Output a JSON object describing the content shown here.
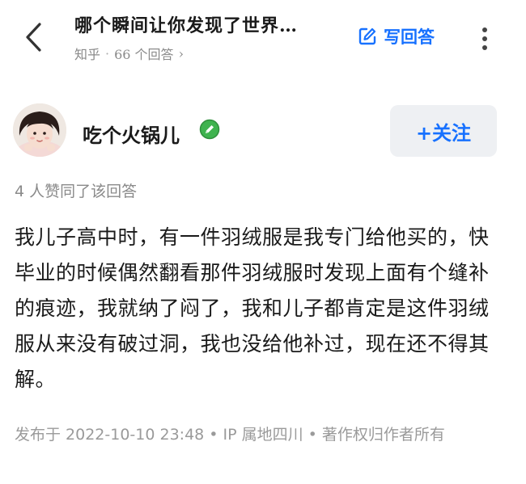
{
  "header": {
    "question_title": "哪个瞬间让你发现了世界…",
    "site_name": "知乎",
    "separator": "·",
    "answer_count": "66 个回答",
    "chevron": "›",
    "write_answer_label": "写回答",
    "back_icon": "chevron-left-icon",
    "more_icon": "more-vertical-icon"
  },
  "author": {
    "name": "吃个火锅儿",
    "badge_icon": "edit-badge-icon",
    "badge_color": "#3fb34f",
    "follow_label": "+关注"
  },
  "likes_text": "4 人赞同了该回答",
  "answer_text": "我儿子高中时，有一件羽绒服是我专门给他买的，快毕业的时候偶然翻看那件羽绒服时发现上面有个缝补的痕迹，我就纳了闷了，我和儿子都肯定是这件羽绒服从来没有破过洞，我也没给他补过，现在还不得其解。",
  "meta_text": "发布于 2022-10-10 23:48 • IP 属地四川 • 著作权归作者所有",
  "colors": {
    "accent": "#1771ff",
    "muted": "#8a8a8a",
    "follow_bg": "#eef0f3"
  }
}
